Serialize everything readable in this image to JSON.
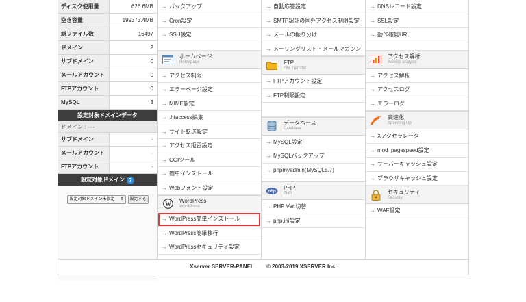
{
  "stats": {
    "top_rows": [
      {
        "label": "ディスク使用量",
        "value": "626.6MB"
      },
      {
        "label": "空き容量",
        "value": "199373.4MB"
      },
      {
        "label": "総ファイル数",
        "value": "16497"
      },
      {
        "label": "ドメイン",
        "value": "2"
      },
      {
        "label": "サブドメイン",
        "value": "0"
      },
      {
        "label": "メールアカウント",
        "value": "0"
      },
      {
        "label": "FTPアカウント",
        "value": "0"
      },
      {
        "label": "MySQL",
        "value": "3"
      }
    ],
    "target_domain_data_title": "設定対象ドメインデータ",
    "domain_line": "ドメイン : ----",
    "domain_rows": [
      {
        "label": "サブドメイン",
        "value": "-"
      },
      {
        "label": "メールアカウント",
        "value": "-"
      },
      {
        "label": "FTPアカウント",
        "value": "-"
      }
    ],
    "target_domain_title": "設定対象ドメイン",
    "help": "?",
    "select_value": "設定対象ドメイン未指定",
    "set_button": "設定する"
  },
  "col1": {
    "top": [
      "バックアップ",
      "Cron設定",
      "SSH設定"
    ],
    "homepage": {
      "title": "ホームページ",
      "sub": "Homepage",
      "items": [
        "アクセス制限",
        "エラーページ設定",
        "MIME設定",
        ".htaccess編集",
        "サイト転送設定",
        "アクセス拒否設定",
        "CGIツール",
        "簡単インストール",
        "Webフォント設定"
      ]
    },
    "wordpress": {
      "title": "WordPress",
      "sub": "WordPress",
      "items": [
        "WordPress簡単インストール",
        "WordPress簡単移行",
        "WordPressセキュリティ設定"
      ]
    }
  },
  "col2": {
    "top": [
      "自動応答設定",
      "SMTP認証の国外アクセス制限設定",
      "メールの振り分け",
      "メーリングリスト・メールマガジン"
    ],
    "ftp": {
      "title": "FTP",
      "sub": "File Transfer",
      "items": [
        "FTPアカウント設定",
        "FTP制限設定"
      ]
    },
    "db": {
      "title": "データベース",
      "sub": "Database",
      "items": [
        "MySQL設定",
        "MySQLバックアップ",
        "phpmyadmin(MySQL5.7)"
      ]
    },
    "php": {
      "title": "PHP",
      "sub": "PHP",
      "items": [
        "PHP Ver.切替",
        "php.ini設定"
      ]
    }
  },
  "col3": {
    "top": [
      "DNSレコード設定",
      "SSL設定",
      "動作確認URL"
    ],
    "access": {
      "title": "アクセス解析",
      "sub": "Access analysis",
      "items": [
        "アクセス解析",
        "アクセスログ",
        "エラーログ"
      ]
    },
    "speed": {
      "title": "高速化",
      "sub": "Speeding Up",
      "items": [
        "Xアクセラレータ",
        "mod_pagespeed設定",
        "サーバーキャッシュ設定",
        "ブラウザキャッシュ設定"
      ]
    },
    "security": {
      "title": "セキュリティ",
      "sub": "Security",
      "items": [
        "WAF設定"
      ]
    }
  },
  "footer": {
    "left": "Xserver SERVER-PANEL",
    "right": "© 2003-2019 XSERVER Inc."
  }
}
